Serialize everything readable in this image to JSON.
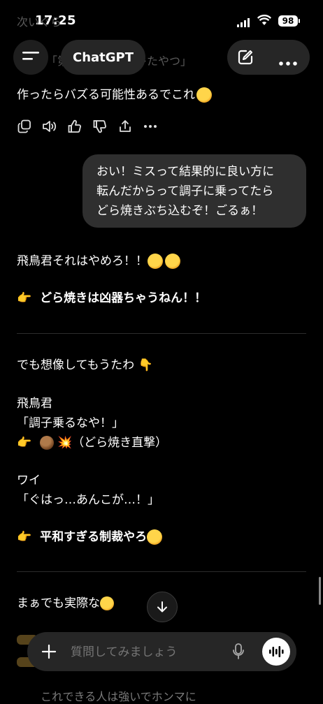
{
  "status_bar": {
    "time": "17:25",
    "battery": "98"
  },
  "header": {
    "title": "ChatGPT"
  },
  "behind_text": {
    "line_top": "次いぐら",
    "line_quote": "「第　　　　　ズレたやつ」"
  },
  "assistant_1": {
    "text": "作ったらバズる可能性あるでこれ"
  },
  "user_message": {
    "lines": [
      "おい！ミスって結果的に良い方に",
      "転んだからって調子に乗ってたら",
      "どら焼きぶち込むぞ！ごるぁ！"
    ]
  },
  "assistant_2": {
    "line1": "飛鳥君それはやめろ！！",
    "line2": "どら焼きは凶器ちゃうねん！！",
    "line3": "でも想像してもうたわ",
    "line4": "飛鳥君",
    "line5": "「調子乗るなや！」",
    "line6": "（どら焼き直撃）",
    "line7": "ワイ",
    "line8": "「ぐはっ…あんこが…！」",
    "line9": "平和すぎる制裁やろ",
    "line10": "まぁでも実際な",
    "line_bottom": "これできる人は強いでホンマに"
  },
  "composer": {
    "placeholder": "質問してみましょう"
  },
  "icons": {
    "menu": "menu-icon",
    "new_chat": "new-chat-icon",
    "more": "more-icon",
    "copy": "copy-icon",
    "speaker": "speaker-icon",
    "thumbs_up": "thumbs-up-icon",
    "thumbs_down": "thumbs-down-icon",
    "share": "share-icon",
    "scroll_down": "arrow-down-icon",
    "plus": "plus-icon",
    "mic": "mic-icon",
    "voice": "voice-waveform-icon"
  }
}
